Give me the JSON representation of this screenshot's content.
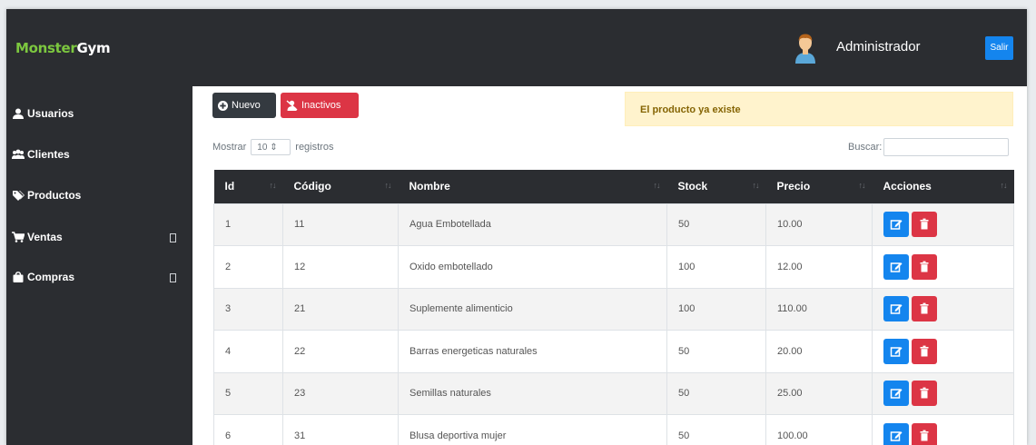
{
  "brand": {
    "part1": "Monster",
    "part2": "Gym"
  },
  "header": {
    "user_name": "Administrador",
    "logout_label": "Salir"
  },
  "sidebar": {
    "items": [
      {
        "label": "Usuarios",
        "icon": "user-icon"
      },
      {
        "label": "Clientes",
        "icon": "users-icon"
      },
      {
        "label": "Productos",
        "icon": "tags-icon"
      },
      {
        "label": "Ventas",
        "icon": "cart-icon",
        "has_submenu": true
      },
      {
        "label": "Compras",
        "icon": "bag-icon",
        "has_submenu": true
      }
    ]
  },
  "toolbar": {
    "new_label": "Nuevo",
    "inactive_label": "Inactivos"
  },
  "alert": {
    "message": "El producto ya existe",
    "color": "#fff3cd"
  },
  "table_controls": {
    "show_label": "Mostrar",
    "page_size": "10",
    "records_label": "registros",
    "search_label": "Buscar:"
  },
  "table": {
    "columns": [
      "Id",
      "Código",
      "Nombre",
      "Stock",
      "Precio",
      "Acciones"
    ],
    "rows": [
      {
        "id": "1",
        "codigo": "11",
        "nombre": "Agua Embotellada",
        "stock": "50",
        "precio": "10.00"
      },
      {
        "id": "2",
        "codigo": "12",
        "nombre": "Oxido embotellado",
        "stock": "100",
        "precio": "12.00"
      },
      {
        "id": "3",
        "codigo": "21",
        "nombre": "Suplemente alimenticio",
        "stock": "100",
        "precio": "110.00"
      },
      {
        "id": "4",
        "codigo": "22",
        "nombre": "Barras energeticas naturales",
        "stock": "50",
        "precio": "20.00"
      },
      {
        "id": "5",
        "codigo": "23",
        "nombre": "Semillas naturales",
        "stock": "50",
        "precio": "25.00"
      },
      {
        "id": "6",
        "codigo": "31",
        "nombre": "Blusa deportiva mujer",
        "stock": "50",
        "precio": "100.00"
      }
    ]
  },
  "colors": {
    "dark": "#2b2d31",
    "brand_green": "#7cc73f",
    "primary": "#1485ee",
    "danger": "#dc3545"
  }
}
